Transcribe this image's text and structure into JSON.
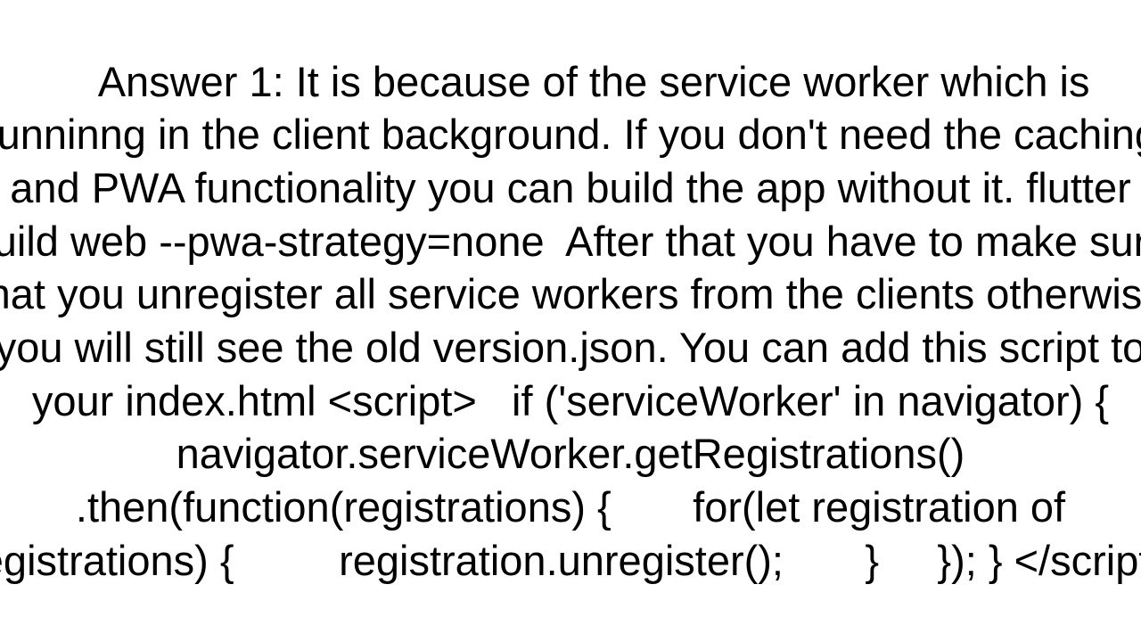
{
  "answer": {
    "label": "Answer 1:",
    "body": "It is because of the service worker which is runninng in the client background. If you don't need the caching and PWA functionality you can build the app without it. flutter build web --pwa-strategy=none  After that you have to make sure that you unregister all service workers from the clients otherwise you will still see the old version.json. You can add this script to your index.html <script>   if ('serviceWorker' in navigator) {     navigator.serviceWorker.getRegistrations()     .then(function(registrations) {       for(let registration of registrations) {         registration.unregister();       }     }); } </script>"
  }
}
